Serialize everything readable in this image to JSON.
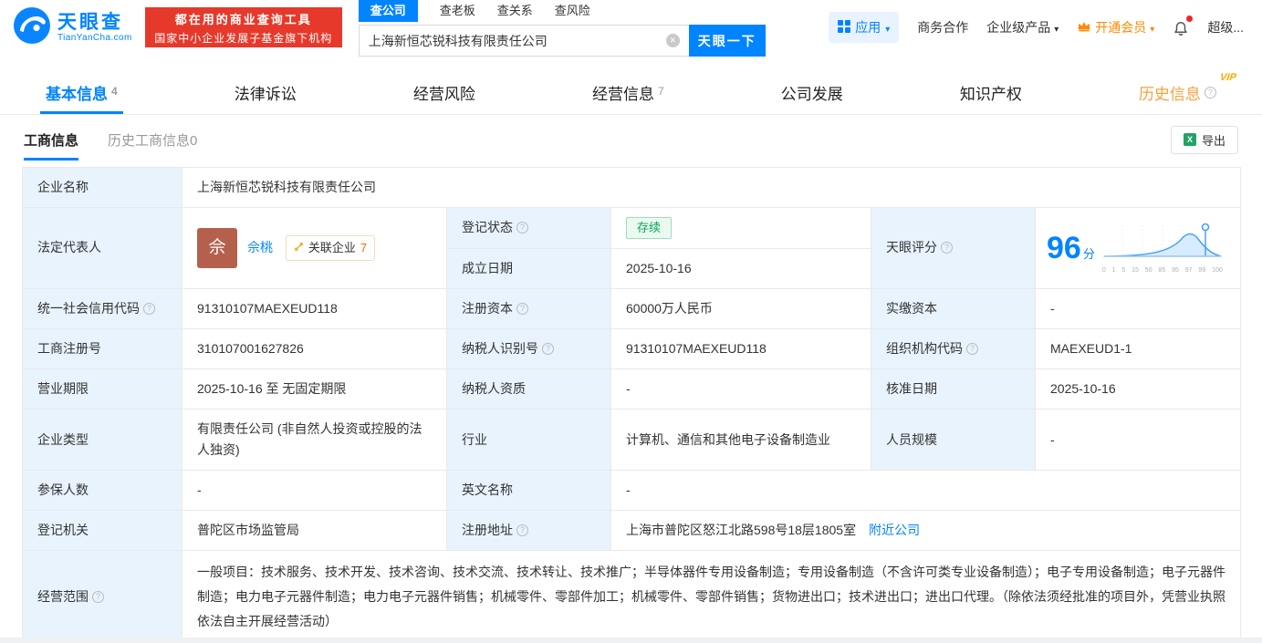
{
  "header": {
    "logo": {
      "brand": "天眼查",
      "domain": "TianYanCha.com"
    },
    "promo": {
      "line1": "都在用的商业查询工具",
      "line2": "国家中小企业发展子基金旗下机构"
    },
    "search_tabs": [
      {
        "label": "查公司"
      },
      {
        "label": "查老板"
      },
      {
        "label": "查关系"
      },
      {
        "label": "查风险"
      }
    ],
    "search": {
      "value": "上海新恒芯锐科技有限责任公司",
      "button": "天眼一下"
    },
    "nav": {
      "apps": "应用",
      "cooperation": "商务合作",
      "enterprise": "企业级产品",
      "vip": "开通会员",
      "user": "超级..."
    }
  },
  "tabs": {
    "basic": {
      "label": "基本信息",
      "count": "4"
    },
    "legal": {
      "label": "法律诉讼"
    },
    "risk": {
      "label": "经营风险"
    },
    "operation": {
      "label": "经营信息",
      "count": "7"
    },
    "development": {
      "label": "公司发展"
    },
    "ip": {
      "label": "知识产权"
    },
    "history": {
      "label": "历史信息",
      "vip": "VIP"
    }
  },
  "subtabs": {
    "business": "工商信息",
    "history": "历史工商信息0",
    "export": "导出"
  },
  "table": {
    "labels": {
      "company_name": "企业名称",
      "legal_rep": "法定代表人",
      "reg_status": "登记状态",
      "establish_date": "成立日期",
      "score": "天眼评分",
      "credit_code": "统一社会信用代码",
      "reg_capital": "注册资本",
      "paid_capital": "实缴资本",
      "reg_number": "工商注册号",
      "taxpayer_id": "纳税人识别号",
      "org_code": "组织机构代码",
      "business_term": "营业期限",
      "taxpayer_quality": "纳税人资质",
      "approval_date": "核准日期",
      "company_type": "企业类型",
      "industry": "行业",
      "staff_size": "人员规模",
      "insured_count": "参保人数",
      "english_name": "英文名称",
      "reg_authority": "登记机关",
      "reg_address": "注册地址",
      "business_scope": "经营范围"
    },
    "values": {
      "company_name": "上海新恒芯锐科技有限责任公司",
      "legal_rep_avatar": "佘",
      "legal_rep_name": "佘桃",
      "related_label": "关联企业",
      "related_count": "7",
      "reg_status": "存续",
      "establish_date": "2025-10-16",
      "score": "96",
      "score_unit": "分",
      "score_ticks": [
        "0",
        "1",
        "5",
        "15",
        "50",
        "85",
        "95",
        "97",
        "99",
        "100"
      ],
      "credit_code": "91310107MAEXEUD118",
      "reg_capital": "60000万人民币",
      "paid_capital": "-",
      "reg_number": "310107001627826",
      "taxpayer_id": "91310107MAEXEUD118",
      "org_code": "MAEXEUD1-1",
      "business_term": "2025-10-16 至 无固定期限",
      "taxpayer_quality": "-",
      "approval_date": "2025-10-16",
      "company_type": "有限责任公司 (非自然人投资或控股的法人独资)",
      "industry": "计算机、通信和其他电子设备制造业",
      "staff_size": "-",
      "insured_count": "-",
      "english_name": "-",
      "reg_authority": "普陀区市场监管局",
      "reg_address": "上海市普陀区怒江北路598号18层1805室",
      "nearby_link": "附近公司",
      "business_scope": "一般项目：技术服务、技术开发、技术咨询、技术交流、技术转让、技术推广；半导体器件专用设备制造；专用设备制造（不含许可类专业设备制造）；电子专用设备制造；电子元器件制造；电力电子元器件制造；电力电子元器件销售；机械零件、零部件加工；机械零件、零部件销售；货物进出口；技术进出口；进出口代理。（除依法须经批准的项目外，凭营业执照依法自主开展经营活动）"
    }
  },
  "colors": {
    "brand_blue": "#0084ff",
    "promo_red": "#e6392b",
    "vip_orange": "#ff8a00",
    "status_green": "#00a854",
    "label_bg": "#e8f3fd"
  }
}
